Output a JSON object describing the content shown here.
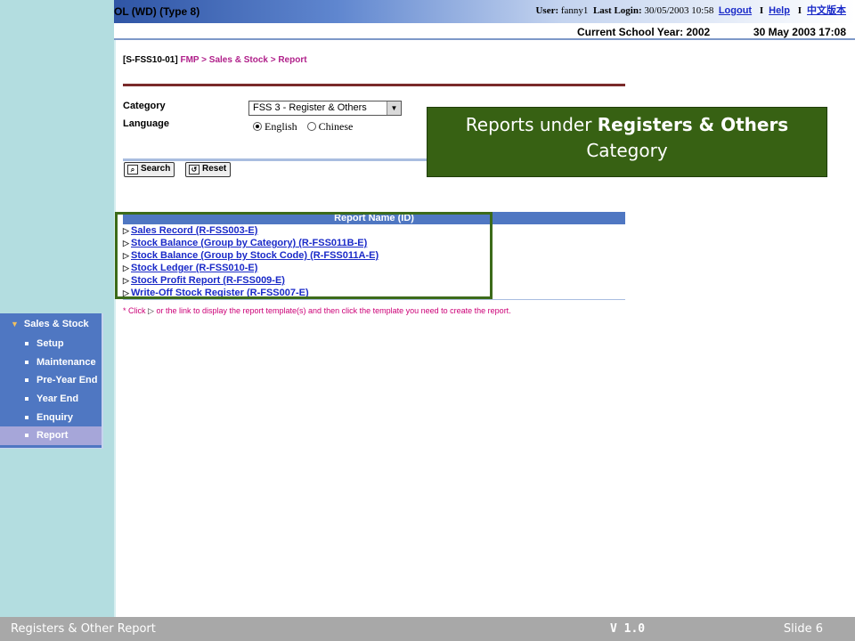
{
  "header": {
    "system_title": "OL (WD) (Type 8)",
    "user_label": "User:",
    "user_name": "fanny1",
    "last_login_label": "Last Login:",
    "last_login_value": "30/05/2003 10:58",
    "logout": "Logout",
    "help": "Help",
    "chinese_version": "中文版本",
    "separator": "I",
    "school_year": "Current School Year: 2002",
    "datetime": "30 May 2003 17:08"
  },
  "breadcrumb": {
    "code": "[S-FSS10-01]",
    "path": "FMP > Sales & Stock > Report"
  },
  "form": {
    "category_label": "Category",
    "category_value": "FSS 3 - Register & Others",
    "language_label": "Language",
    "language_options": [
      "English",
      "Chinese"
    ],
    "language_selected": "English",
    "search_button": "Search",
    "reset_button": "Reset"
  },
  "report_table": {
    "header": "Report Name (ID)",
    "items": [
      "Sales Record (R-FSS003-E)",
      "Stock Balance (Group by Category) (R-FSS011B-E)",
      "Stock Balance (Group by Stock Code) (R-FSS011A-E)",
      "Stock Ledger (R-FSS010-E)",
      "Stock Profit Report (R-FSS009-E)",
      "Write-Off Stock Register (R-FSS007-E)"
    ],
    "note_prefix": "* Click",
    "note_suffix": "or the link to display the report template(s) and then click the template you need to create the report."
  },
  "callout": {
    "line1_prefix": "Reports under",
    "line1_bold": "Registers & Others",
    "line2": "Category"
  },
  "nav": {
    "section": "Sales & Stock",
    "items": [
      "Setup",
      "Maintenance",
      "Pre-Year End",
      "Year End",
      "Enquiry",
      "Report"
    ],
    "active": "Report"
  },
  "footer": {
    "left": "Registers & Other Report",
    "version": "V 1.0",
    "slide": "Slide 6"
  },
  "colors": {
    "callout_bg": "#376113",
    "nav_bg": "#4f77c2",
    "link": "#1a2ac8",
    "breadcrumb": "#b0208a"
  }
}
